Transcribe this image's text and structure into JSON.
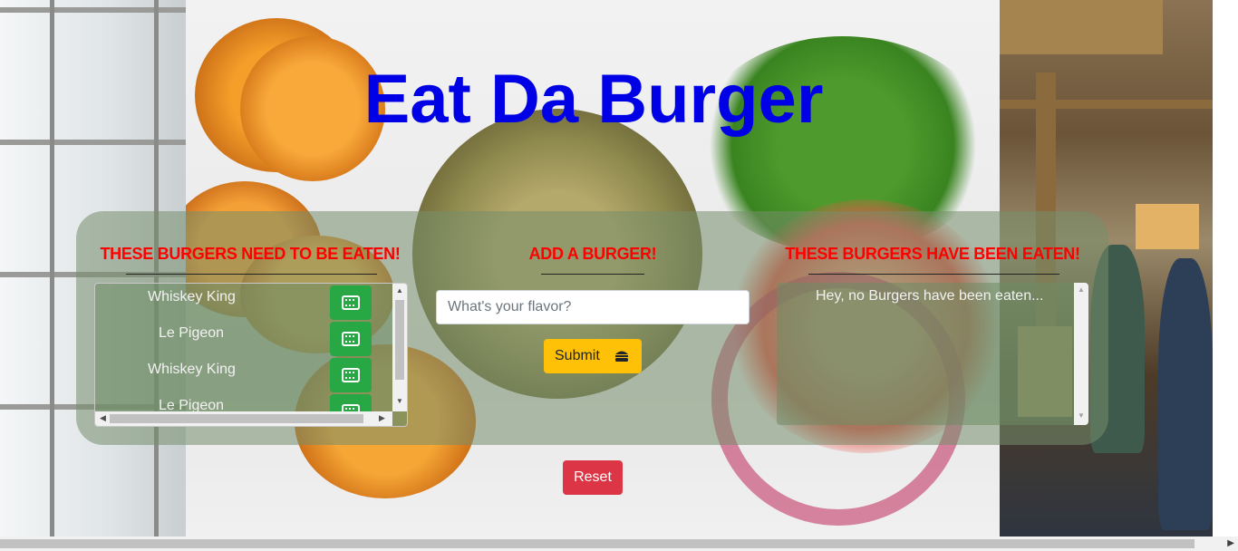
{
  "header": {
    "title": "Eat Da Burger"
  },
  "columns": {
    "uneaten": {
      "heading": "THESE BURGERS NEED TO BE EATEN!"
    },
    "add": {
      "heading": "ADD A BURGER!"
    },
    "eaten": {
      "heading": "THESE BURGERS HAVE BEEN EATEN!"
    }
  },
  "burgers": [
    {
      "name": "Whiskey King",
      "action_icon": "devour-icon"
    },
    {
      "name": "Le Pigeon",
      "action_icon": "devour-icon"
    },
    {
      "name": "Whiskey King",
      "action_icon": "devour-icon"
    },
    {
      "name": "Le Pigeon",
      "action_icon": "devour-icon"
    }
  ],
  "form": {
    "placeholder": "What's your flavor?",
    "value": "",
    "submit_label": "Submit",
    "submit_icon": "hamburger-icon"
  },
  "eaten": {
    "empty_message": "Hey, no Burgers have been eaten..."
  },
  "reset": {
    "label": "Reset"
  },
  "colors": {
    "title": "#0000e6",
    "heading": "#ff0000",
    "devour": "#28a745",
    "submit": "#ffc107",
    "reset": "#dc3545"
  }
}
